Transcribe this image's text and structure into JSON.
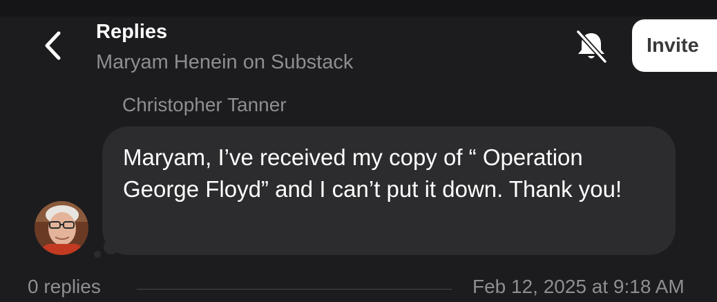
{
  "header": {
    "back_icon": "chevron-left-icon",
    "title": "Replies",
    "subtitle": "Maryam Henein on Substack",
    "mute_icon": "bell-slash-icon",
    "invite_label": "Invite"
  },
  "message": {
    "sender": "Christopher Tanner",
    "text": "Maryam, I’ve received my copy of “ Operation George Floyd” and I can’t put it down. Thank you!",
    "avatar": "user-avatar"
  },
  "footer": {
    "replies": "0 replies",
    "timestamp": "Feb 12, 2025 at 9:18 AM"
  },
  "colors": {
    "background": "#1c1c1e",
    "bubble": "#2c2c2e",
    "secondary_text": "#8e8e93",
    "invite_bg": "#ffffff"
  }
}
